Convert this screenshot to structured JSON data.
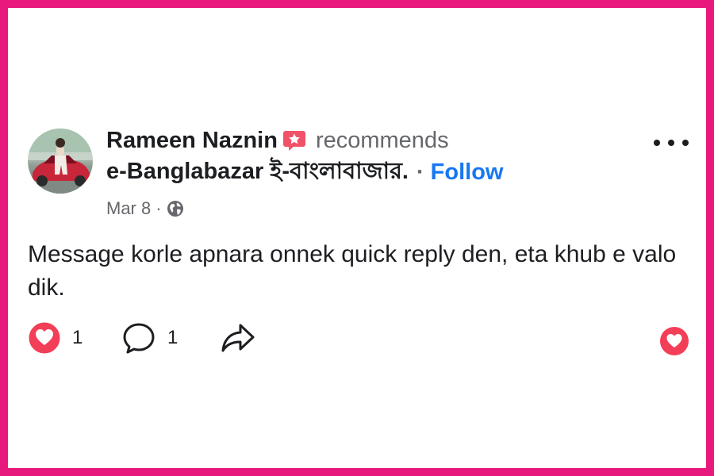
{
  "post": {
    "author": "Rameen Naznin",
    "action_text": "recommends",
    "page_name": "e-Banglabazar ই-বাংলাবাজার.",
    "separator": "·",
    "follow_label": "Follow",
    "date": "Mar 8",
    "date_separator": "·",
    "privacy_icon": "globe-icon",
    "text": "Message korle apnara onnek quick reply den, eta khub e valo dik."
  },
  "actions": {
    "like_count": "1",
    "comment_count": "1"
  },
  "colors": {
    "frame": "#e8197c",
    "follow": "#1877f2",
    "like": "#f33e58",
    "recommend_badge": "#f25268"
  }
}
